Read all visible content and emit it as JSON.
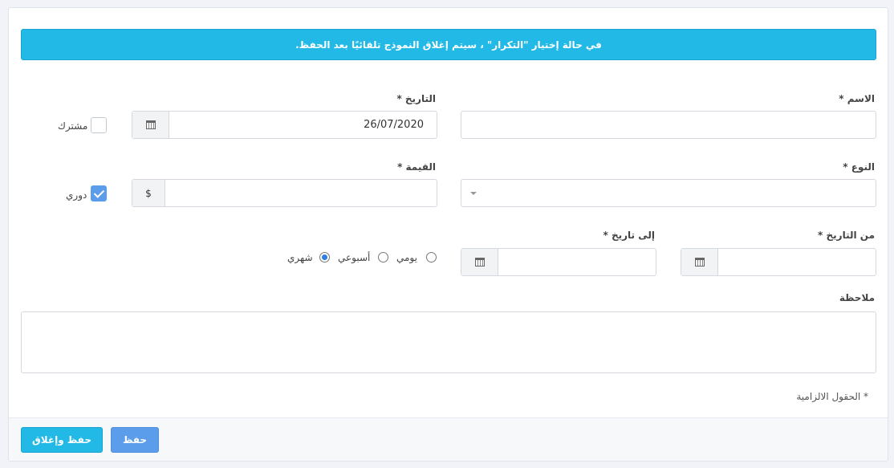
{
  "alert": {
    "text": "في حالة إختيار \"التكرار\" ، سيتم إغلاق النموذج تلقائيًا بعد الحفظ."
  },
  "form": {
    "name": {
      "label": "الاسم *",
      "value": ""
    },
    "date": {
      "label": "التاريخ *",
      "value": "26/07/2020"
    },
    "shared": {
      "label": "مشترك",
      "checked": false
    },
    "type": {
      "label": "النوع *",
      "value": ""
    },
    "amount": {
      "label": "القيمة *",
      "currency": "$",
      "value": ""
    },
    "recurring": {
      "label": "دوري",
      "checked": true
    },
    "from_date": {
      "label": "من التاريخ *",
      "value": ""
    },
    "to_date": {
      "label": "إلى تاريخ *",
      "value": ""
    },
    "frequency": {
      "options": [
        "يومي",
        "أسبوعي",
        "شهري"
      ],
      "selected": "شهري"
    },
    "note": {
      "label": "ملاحظة",
      "value": ""
    },
    "required_note": "* الحقول الالزامية"
  },
  "footer": {
    "save_label": "حفظ",
    "save_close_label": "حفظ وإغلاق"
  },
  "colors": {
    "alert": "#22b9e6",
    "primary": "#5b9dea",
    "radio": "#2d7fe0"
  }
}
